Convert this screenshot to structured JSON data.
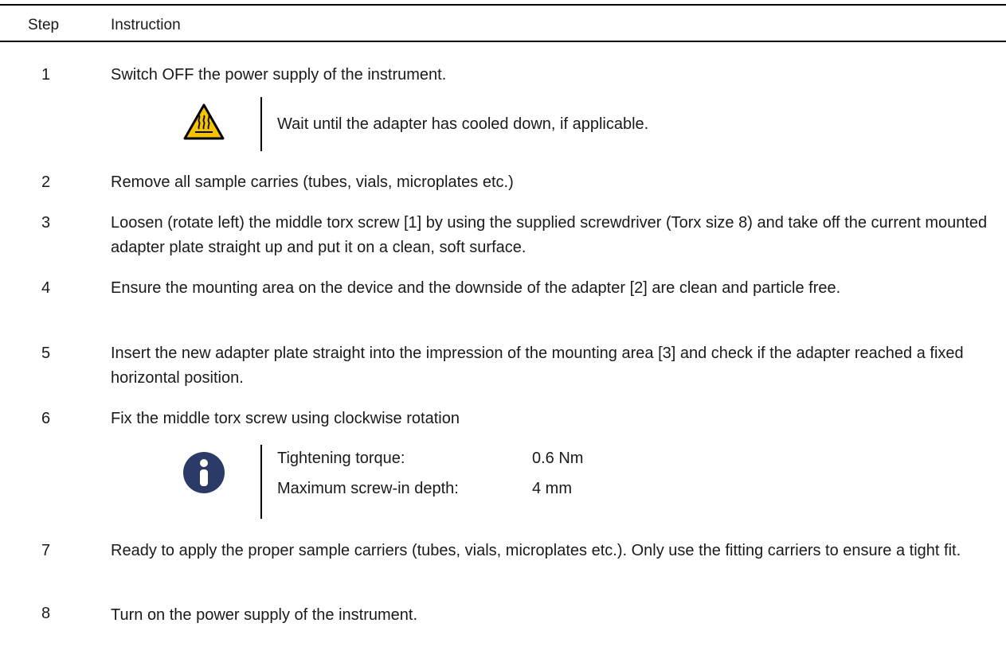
{
  "header": {
    "step_label": "Step",
    "instruction_label": "Instruction"
  },
  "steps": [
    {
      "num": "1",
      "text": "Switch OFF the power supply of the instrument."
    },
    {
      "num": "2",
      "text": "Remove all sample carries (tubes, vials, microplates etc.)"
    },
    {
      "num": "3",
      "text": "Loosen (rotate left) the middle torx screw [1] by using the supplied screwdriver (Torx size 8) and take off the current mounted adapter plate straight up and put it on a clean, soft surface."
    },
    {
      "num": "4",
      "text": "Ensure the mounting area on the device and the downside of the adapter [2] are clean and particle free."
    },
    {
      "num": "5",
      "text": "Insert the new adapter plate straight into the impression of the mounting area [3] and check if the adapter reached a fixed horizontal position."
    },
    {
      "num": "6",
      "text": "Fix the middle torx screw using clockwise rotation"
    },
    {
      "num": "7",
      "text": "Ready to apply the proper sample carriers (tubes, vials, microplates etc.). Only use the fitting carriers to ensure a tight fit."
    },
    {
      "num": "8",
      "text": "Turn on the power supply of the instrument."
    }
  ],
  "warning_note": {
    "icon": "hot-surface-warning-icon",
    "text": "Wait until the adapter has cooled down, if applicable."
  },
  "info_note": {
    "icon": "info-icon",
    "rows": [
      {
        "label": "Tightening torque:",
        "value": "0.6 Nm"
      },
      {
        "label": "Maximum screw-in depth:",
        "value": "4 mm"
      }
    ]
  },
  "colors": {
    "warning_fill": "#F5C400",
    "info_fill": "#2B3A67",
    "rule": "#000000"
  }
}
